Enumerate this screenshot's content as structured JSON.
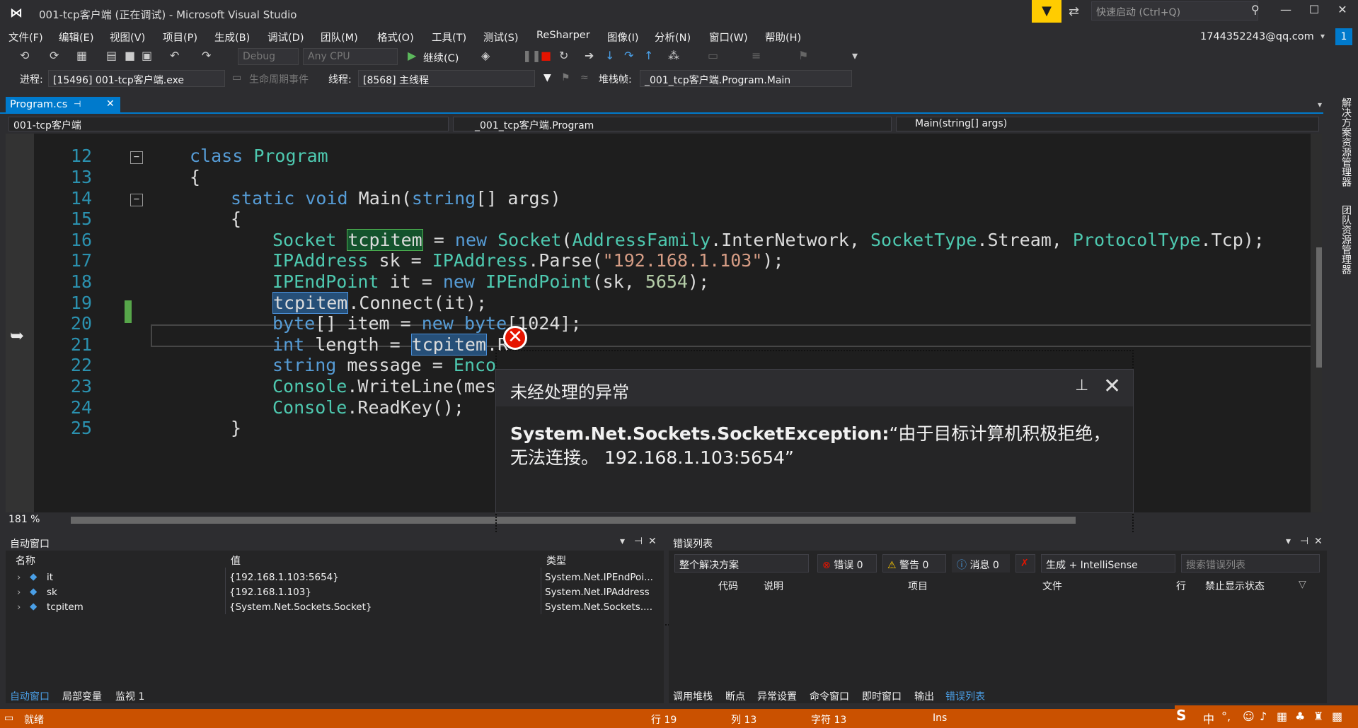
{
  "window": {
    "title": "001-tcp客户端 (正在调试) - Microsoft Visual Studio",
    "quick_launch_placeholder": "快速启动 (Ctrl+Q)",
    "account": "1744352243@qq.com",
    "notification_count": "1"
  },
  "menu": [
    "文件(F)",
    "编辑(E)",
    "视图(V)",
    "项目(P)",
    "生成(B)",
    "调试(D)",
    "团队(M)",
    "格式(O)",
    "工具(T)",
    "测试(S)",
    "ReSharper",
    "图像(I)",
    "分析(N)",
    "窗口(W)",
    "帮助(H)"
  ],
  "toolbar": {
    "config": "Debug",
    "platform": "Any CPU",
    "continue_label": "继续(C)"
  },
  "debug_location": {
    "process_label": "进程:",
    "process_value": "[15496] 001-tcp客户端.exe",
    "lifecycle_label": "生命周期事件",
    "thread_label": "线程:",
    "thread_value": "[8568] 主线程",
    "stackframe_label": "堆栈帧:",
    "stackframe_value": "_001_tcp客户端.Program.Main"
  },
  "tab": {
    "label": "Program.cs"
  },
  "navbar": {
    "project": "001-tcp客户端",
    "class": "_001_tcp客户端.Program",
    "member": "Main(string[] args)"
  },
  "code_lines": [
    {
      "num": "12"
    },
    {
      "num": "13"
    },
    {
      "num": "14"
    },
    {
      "num": "15"
    },
    {
      "num": "16"
    },
    {
      "num": "17"
    },
    {
      "num": "18"
    },
    {
      "num": "19"
    },
    {
      "num": "20"
    },
    {
      "num": "21"
    },
    {
      "num": "22"
    },
    {
      "num": "23"
    },
    {
      "num": "24"
    },
    {
      "num": "25"
    }
  ],
  "editor": {
    "zoom": "181 %"
  },
  "exception": {
    "title": "未经处理的异常",
    "type": "System.Net.Sockets.SocketException:",
    "message": "“由于目标计算机积极拒绝，无法连接。 192.168.1.103:5654”"
  },
  "autos": {
    "title": "自动窗口",
    "columns": {
      "name": "名称",
      "value": "值",
      "type": "类型"
    },
    "rows": [
      {
        "name": "it",
        "value": "{192.168.1.103:5654}",
        "type": "System.Net.IPEndPoi..."
      },
      {
        "name": "sk",
        "value": "{192.168.1.103}",
        "type": "System.Net.IPAddress"
      },
      {
        "name": "tcpitem",
        "value": "{System.Net.Sockets.Socket}",
        "type": "System.Net.Sockets...."
      }
    ],
    "bottom_tabs": [
      "自动窗口",
      "局部变量",
      "监视 1"
    ]
  },
  "errors": {
    "title": "错误列表",
    "scope": "整个解决方案",
    "errors_label": "错误 0",
    "warnings_label": "警告 0",
    "messages_label": "消息 0",
    "build_filter": "生成 + IntelliSense",
    "search_placeholder": "搜索错误列表",
    "columns": {
      "code": "代码",
      "desc": "说明",
      "project": "项目",
      "file": "文件",
      "line": "行",
      "suppress": "禁止显示状态"
    },
    "bottom_tabs": [
      "调用堆栈",
      "断点",
      "异常设置",
      "命令窗口",
      "即时窗口",
      "输出",
      "错误列表"
    ]
  },
  "side_tabs": [
    "解决方案资源管理器",
    "团队资源管理器"
  ],
  "status": {
    "ready": "就绪",
    "row": "行 19",
    "col": "列 13",
    "char": "字符 13",
    "mode": "Ins"
  },
  "ime": {
    "lang": "中"
  },
  "colors": {
    "accent": "#007acc",
    "status": "#ca5100",
    "error": "#e51400"
  }
}
